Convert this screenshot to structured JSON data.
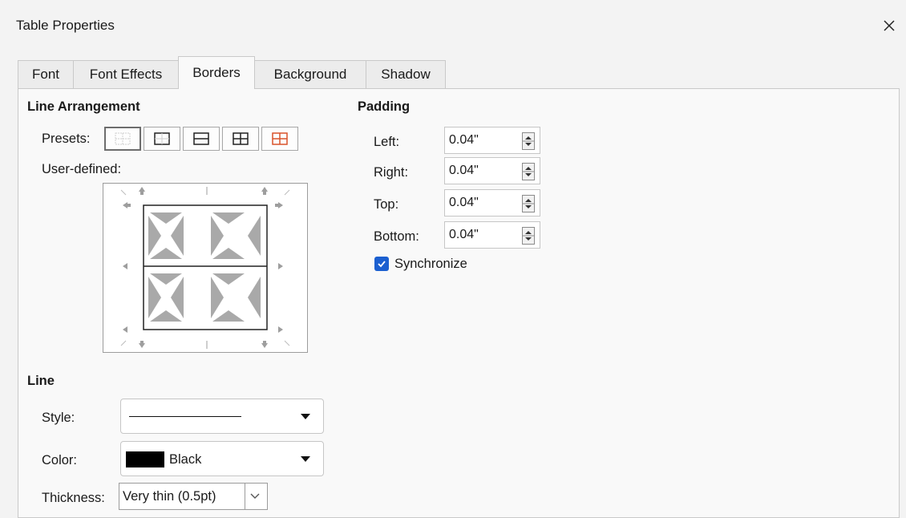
{
  "window": {
    "title": "Table Properties"
  },
  "tabs": [
    {
      "label": "Font"
    },
    {
      "label": "Font Effects"
    },
    {
      "label": "Borders",
      "active": true
    },
    {
      "label": "Background"
    },
    {
      "label": "Shadow"
    }
  ],
  "line_arrangement": {
    "heading": "Line Arrangement",
    "presets_label": "Presets:",
    "user_defined_label": "User-defined:",
    "presets": [
      {
        "name": "no-borders",
        "selected": true
      },
      {
        "name": "outer-border-only"
      },
      {
        "name": "outer-border-horizontal-lines"
      },
      {
        "name": "outer-border-all-inner-lines"
      },
      {
        "name": "outer-border-no-inner-change",
        "accent": "#d9532b"
      }
    ]
  },
  "padding": {
    "heading": "Padding",
    "fields": [
      {
        "label": "Left:",
        "value": "0.04\""
      },
      {
        "label": "Right:",
        "value": "0.04\""
      },
      {
        "label": "Top:",
        "value": "0.04\""
      },
      {
        "label": "Bottom:",
        "value": "0.04\""
      }
    ],
    "synchronize": {
      "label": "Synchronize",
      "checked": true
    }
  },
  "line": {
    "heading": "Line",
    "style_label": "Style:",
    "color_label": "Color:",
    "color_value": "Black",
    "color_swatch": "#000000",
    "thickness_label": "Thickness:",
    "thickness_value": "Very thin (0.5pt)"
  },
  "colors": {
    "accent": "#1b5fd0",
    "preset_accent": "#d9532b"
  }
}
